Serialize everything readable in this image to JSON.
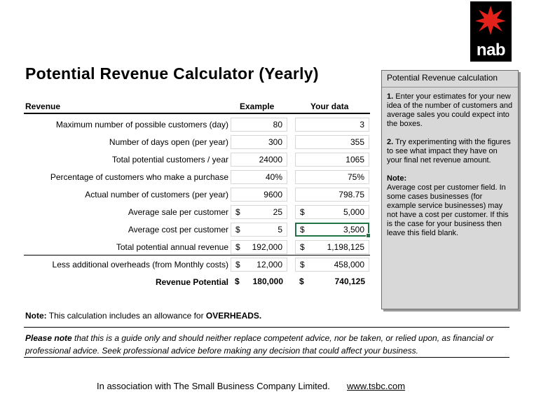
{
  "logo": {
    "text": "nab",
    "colors": {
      "background": "#000000",
      "star": "#e4221c"
    }
  },
  "title": "Potential Revenue Calculator (Yearly)",
  "columns": {
    "label": "Revenue",
    "example": "Example",
    "yours": "Your data"
  },
  "rows": [
    {
      "label": "Maximum number of possible customers (day)",
      "example": {
        "cur": "",
        "val": "80"
      },
      "yours": {
        "cur": "",
        "val": "3"
      }
    },
    {
      "label": "Number of days open (per year)",
      "example": {
        "cur": "",
        "val": "300"
      },
      "yours": {
        "cur": "",
        "val": "355"
      }
    },
    {
      "label": "Total potential customers / year",
      "example": {
        "cur": "",
        "val": "24000"
      },
      "yours": {
        "cur": "",
        "val": "1065"
      }
    },
    {
      "label": "Percentage of customers who make a purchase",
      "example": {
        "cur": "",
        "val": "40%"
      },
      "yours": {
        "cur": "",
        "val": "75%"
      }
    },
    {
      "label": "Actual number of customers (per year)",
      "example": {
        "cur": "",
        "val": "9600"
      },
      "yours": {
        "cur": "",
        "val": "798.75"
      }
    },
    {
      "label": "Average sale per customer",
      "example": {
        "cur": "$",
        "val": "25"
      },
      "yours": {
        "cur": "$",
        "val": "5,000"
      }
    },
    {
      "label": "Average cost per customer",
      "example": {
        "cur": "$",
        "val": "5"
      },
      "yours": {
        "cur": "$",
        "val": "3,500"
      }
    },
    {
      "label": "Total potential annual revenue",
      "example": {
        "cur": "$",
        "val": "192,000"
      },
      "yours": {
        "cur": "$",
        "val": "1,198,125"
      }
    },
    {
      "label": "Less additional overheads (from Monthly costs)",
      "example": {
        "cur": "$",
        "val": "12,000"
      },
      "yours": {
        "cur": "$",
        "val": "458,000"
      }
    },
    {
      "label": "Revenue Potential",
      "example": {
        "cur": "$",
        "val": "180,000"
      },
      "yours": {
        "cur": "$",
        "val": "740,125"
      }
    }
  ],
  "side_panel": {
    "title": "Potential Revenue calculation",
    "step1_num": "1.",
    "step1_text": "Enter your estimates for your new idea of the number of customers and average sales you could expect into the boxes.",
    "step2_num": "2.",
    "step2_text": "Try experimenting with the figures to see what impact they have on your final net revenue amount.",
    "note_label": "Note:",
    "note_text": "Average cost per customer field. In some cases businesses (for example service businesses) may not have a cost per customer.  If this is the case for your business then leave this field blank."
  },
  "note": {
    "label": "Note:",
    "text": "This calculation includes an allowance for ",
    "emph": "OVERHEADS."
  },
  "disclaimer": {
    "label": "Please note",
    "text": "that this is a guide only and should neither replace competent advice, nor be taken, or relied upon, as financial or professional advice.  Seek professional advice before making any decision that could affect your business."
  },
  "footer": {
    "text": "In association with The Small Business Company Limited.",
    "link": "www.tsbc.com"
  }
}
